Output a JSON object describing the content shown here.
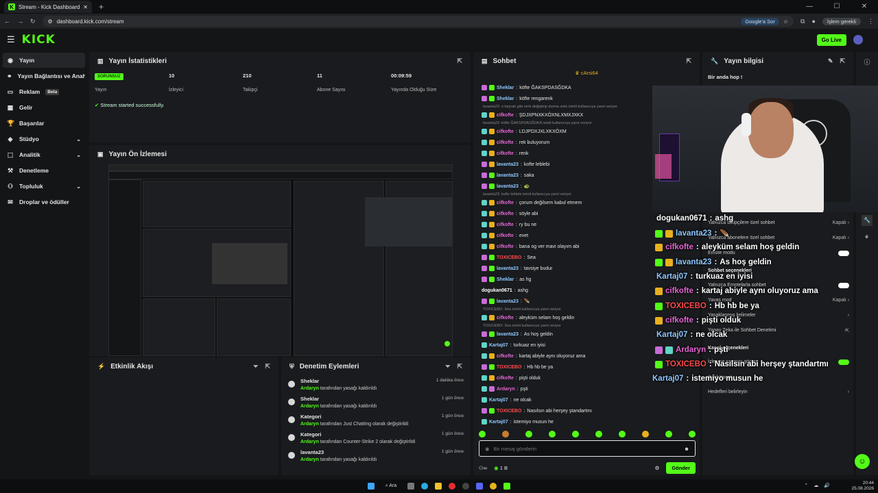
{
  "browser": {
    "tab_title": "Stream - Kick Dashboard",
    "url": "dashboard.kick.com/stream",
    "google_pill": "Google'a Sor",
    "update_label": "İşlem gerekli"
  },
  "header": {
    "logo": "KICK",
    "go_live": "Go Live"
  },
  "sidebar": {
    "items": [
      {
        "label": "Yayın",
        "icon": "broadcast-icon",
        "active": true
      },
      {
        "label": "Yayın Bağlantısı ve Anahtarı",
        "icon": "link-icon"
      },
      {
        "label": "Reklam",
        "icon": "ad-icon",
        "badge": "Beta"
      },
      {
        "label": "Gelir",
        "icon": "revenue-icon"
      },
      {
        "label": "Başarılar",
        "icon": "trophy-icon"
      },
      {
        "label": "Stüdyo",
        "icon": "studio-icon",
        "chevron": true
      },
      {
        "label": "Analitik",
        "icon": "analytics-icon",
        "chevron": true
      },
      {
        "label": "Denetleme",
        "icon": "gavel-icon"
      },
      {
        "label": "Topluluk",
        "icon": "community-icon",
        "chevron": true
      },
      {
        "label": "Droplar ve ödüller",
        "icon": "gift-icon"
      }
    ]
  },
  "stats": {
    "title": "Yayın İstatistikleri",
    "badge": "SORUNSUZ",
    "items": [
      {
        "value": "",
        "label": "Yayın"
      },
      {
        "value": "10",
        "label": "İzleyici"
      },
      {
        "value": "210",
        "label": "Takipçi"
      },
      {
        "value": "11",
        "label": "Abone Sayısı"
      },
      {
        "value": "00:09:59",
        "label": "Yayında Olduğu Süre"
      }
    ],
    "success_msg": "Stream started successfully."
  },
  "preview": {
    "title": "Yayın Ön İzlemesi"
  },
  "activity": {
    "title": "Etkinlik Akışı"
  },
  "moderation": {
    "title": "Denetim Eylemleri",
    "items": [
      {
        "title": "Sheklar",
        "by": "Ardaryn",
        "text": " tarafından yasağı kaldırıldı",
        "time": "1 dakika önce"
      },
      {
        "title": "Sheklar",
        "by": "Ardaryn",
        "text": " tarafından yasağı kaldırıldı",
        "time": "1 gün önce"
      },
      {
        "title": "Kategori",
        "by": "Ardaryn",
        "text": " tarafından Just Chatting olarak değiştirildi",
        "time": "1 gün önce"
      },
      {
        "title": "Kategori",
        "by": "Ardaryn",
        "text": " tarafından Counter-Strike 2 olarak değiştirildi",
        "time": "1 gün önce"
      },
      {
        "title": "lavanta23",
        "by": "Ardaryn",
        "text": " tarafından yasağı kaldırıldı",
        "time": "1 gün önce"
      }
    ]
  },
  "chat": {
    "title": "Sohbet",
    "pinned": "cArsi64",
    "messages": [
      {
        "user": "Sheklar",
        "color": "#8fc8ff",
        "b1": "#c86bd8",
        "b2": "#53fc18",
        "text": "köfte ĞAKSPDASĞDKA"
      },
      {
        "user": "Sheklar",
        "color": "#8fc8ff",
        "b1": "#c86bd8",
        "b2": "#53fc18",
        "text": "köfte rengarenk"
      },
      {
        "sys": "lavanta23: o bayrak gibi renk değiştirip durma artık isimli kullanıcıya yanıt veriyor"
      },
      {
        "user": "cifkofte",
        "color": "#e565d4",
        "b1": "#5fd4c8",
        "b2": "#e9b01e",
        "text": "ŞDJXPNXKXÖXNLXMXJXKX"
      },
      {
        "sys": "lavanta23: köfte ĞAKSPDASĞDKA isimli kullanıcıya yanıt veriyor"
      },
      {
        "user": "cifkofte",
        "color": "#e565d4",
        "b1": "#5fd4c8",
        "b2": "#e9b01e",
        "text": "LDJPDXJXLXKXÖXM"
      },
      {
        "user": "cifkofte",
        "color": "#e565d4",
        "b1": "#5fd4c8",
        "b2": "#e9b01e",
        "text": "rek buluyorum"
      },
      {
        "user": "cifkofte",
        "color": "#e565d4",
        "b1": "#5fd4c8",
        "b2": "#e9b01e",
        "text": "renk"
      },
      {
        "user": "lavanta23",
        "color": "#8fc8ff",
        "b1": "#c86bd8",
        "b2": "#e9b01e",
        "text": "kofte leblebi"
      },
      {
        "user": "lavanta23",
        "color": "#8fc8ff",
        "b1": "#c86bd8",
        "b2": "#53fc18",
        "text": "saka"
      },
      {
        "user": "lavanta23",
        "color": "#8fc8ff",
        "b1": "#c86bd8",
        "b2": "#53fc18",
        "text": "🐢"
      },
      {
        "sys": "lavanta23: kofte leblebi isimli kullanıcıya yanıt veriyor"
      },
      {
        "user": "cifkofte",
        "color": "#e565d4",
        "b1": "#5fd4c8",
        "b2": "#e9b01e",
        "text": "çorum değilsem kabul etmem"
      },
      {
        "user": "cifkofte",
        "color": "#e565d4",
        "b1": "#5fd4c8",
        "b2": "#e9b01e",
        "text": "söyle abi"
      },
      {
        "user": "cifkofte",
        "color": "#e565d4",
        "b1": "#5fd4c8",
        "b2": "#e9b01e",
        "text": "ry bu ne"
      },
      {
        "user": "cifkofte",
        "color": "#e565d4",
        "b1": "#5fd4c8",
        "b2": "#e9b01e",
        "text": "evet"
      },
      {
        "user": "cifkofte",
        "color": "#e565d4",
        "b1": "#5fd4c8",
        "b2": "#e9b01e",
        "text": "bana og ver mavi olayım abi"
      },
      {
        "user": "TOXICEBO",
        "color": "#ff4a4a",
        "b1": "#c86bd8",
        "b2": "#53fc18",
        "text": "Sea"
      },
      {
        "user": "lavanta23",
        "color": "#8fc8ff",
        "b1": "#c86bd8",
        "b2": "#53fc18",
        "text": "tavsiye budur"
      },
      {
        "user": "Sheklar",
        "color": "#8fc8ff",
        "b1": "#c86bd8",
        "b2": "#53fc18",
        "text": "as hg"
      },
      {
        "user": "dogukan0671",
        "color": "#ffffff",
        "b1": "",
        "b2": "",
        "text": "ashg"
      },
      {
        "user": "lavanta23",
        "color": "#8fc8ff",
        "b1": "#c86bd8",
        "b2": "#53fc18",
        "text": "🪶"
      },
      {
        "sys": "TOXICEBO: Sea isimli kullanıcıya yanıt veriyor"
      },
      {
        "user": "cifkofte",
        "color": "#e565d4",
        "b1": "#5fd4c8",
        "b2": "#e9b01e",
        "text": "aleyküm selam hoş geldin"
      },
      {
        "sys": "TOXICEBO: Sea isimli kullanıcıya yanıt veriyor"
      },
      {
        "user": "lavanta23",
        "color": "#8fc8ff",
        "b1": "#c86bd8",
        "b2": "#53fc18",
        "text": "As hoş geldin"
      },
      {
        "user": "Kartaj07",
        "color": "#8fc8ff",
        "b1": "#5fd4c8",
        "b2": "",
        "text": "turkuaz en iyisi"
      },
      {
        "user": "cifkofte",
        "color": "#e565d4",
        "b1": "#5fd4c8",
        "b2": "#e9b01e",
        "text": "kartaj abiyle aynı oluyoruz ama"
      },
      {
        "user": "TOXICEBO",
        "color": "#ff4a4a",
        "b1": "#c86bd8",
        "b2": "#53fc18",
        "text": "Hb hb be ya"
      },
      {
        "user": "cifkofte",
        "color": "#e565d4",
        "b1": "#5fd4c8",
        "b2": "#e9b01e",
        "text": "pişti olduk"
      },
      {
        "user": "Ardaryn",
        "color": "#e565d4",
        "b1": "#5fd4c8",
        "b2": "#c86bd8",
        "text": "pşti"
      },
      {
        "user": "Kartaj07",
        "color": "#8fc8ff",
        "b1": "#5fd4c8",
        "b2": "",
        "text": "ne olcak"
      },
      {
        "user": "TOXICEBO",
        "color": "#ff4a4a",
        "b1": "#c86bd8",
        "b2": "#53fc18",
        "text": "Nasılsın abi herşey ştandartmı"
      },
      {
        "user": "Kartaj07",
        "color": "#8fc8ff",
        "b1": "#5fd4c8",
        "b2": "",
        "text": "istemiyo musun he"
      }
    ],
    "input_placeholder": "Bir mesaj gönderin",
    "viewer_count": "1 B",
    "send_label": "Gönder"
  },
  "stream_info": {
    "title": "Yayın bilgisi",
    "stream_title": "Bir anda hop !",
    "settings": [
      {
        "label": "Yalnızca takipçilere özel sohbet",
        "value": "Kapalı",
        "type": "chevron"
      },
      {
        "label": "Yalnızca abonelere özel sohbet",
        "value": "Kapalı",
        "type": "chevron"
      },
      {
        "label": "Emote modu",
        "value": "",
        "type": "toggle-off"
      },
      {
        "label": "Sohbet seçenekleri",
        "value": "",
        "type": "heading"
      },
      {
        "label": "Yalnızca Emotelarla sohbet",
        "value": "",
        "type": "toggle-off"
      },
      {
        "label": "Yavaş mod",
        "value": "Kapalı",
        "type": "chevron"
      },
      {
        "label": "Yasaklanmış kelimeler",
        "value": "",
        "type": "chevron"
      },
      {
        "label": "Yapay Zeka ile Sohbet Denetimi",
        "value": "",
        "type": "ext"
      },
      {
        "label": "Kanal seçenekleri",
        "value": "",
        "type": "heading"
      },
      {
        "label": "İzlenme sayısını göster",
        "value": "",
        "type": "toggle-on"
      },
      {
        "label": "Raid Kanalı",
        "value": "",
        "type": "none"
      },
      {
        "label": "Hedefleri belirleyin",
        "value": "",
        "type": "chevron"
      }
    ]
  },
  "overlay_chat": [
    {
      "user": "dogukan0671",
      "color": "#ffffff",
      "b1": "",
      "b2": "",
      "text": "ashg"
    },
    {
      "user": "lavanta23",
      "color": "#8fc8ff",
      "b1": "#53fc18",
      "b2": "#e9b01e",
      "text": "🪶"
    },
    {
      "user": "cifkofte",
      "color": "#e565d4",
      "b1": "#e9b01e",
      "b2": "",
      "text": "aleyküm selam hoş geldin"
    },
    {
      "user": "lavanta23",
      "color": "#8fc8ff",
      "b1": "#53fc18",
      "b2": "#e9b01e",
      "text": "As hoş geldin"
    },
    {
      "user": "Kartaj07",
      "color": "#8fc8ff",
      "b1": "",
      "b2": "",
      "text": "turkuaz en iyisi"
    },
    {
      "user": "cifkofte",
      "color": "#e565d4",
      "b1": "#e9b01e",
      "b2": "",
      "text": "kartaj abiyle aynı oluyoruz ama"
    },
    {
      "user": "TOXICEBO",
      "color": "#ff4a4a",
      "b1": "#53fc18",
      "b2": "",
      "text": "Hb hb be ya"
    },
    {
      "user": "cifkofte",
      "color": "#e565d4",
      "b1": "#e9b01e",
      "b2": "",
      "text": "pişti olduk"
    },
    {
      "user": "Kartaj07",
      "color": "#8fc8ff",
      "b1": "",
      "b2": "",
      "text": "ne olcak"
    },
    {
      "user": "Ardaryn",
      "color": "#e565d4",
      "b1": "#c86bd8",
      "b2": "#5fd4c8",
      "text": "pşti"
    },
    {
      "user": "TOXICEBO",
      "color": "#ff4a4a",
      "b1": "#53fc18",
      "b2": "",
      "text": "Nasılsın abi herşey ştandartmı"
    },
    {
      "user": "Kartaj07",
      "color": "#8fc8ff",
      "b1": "",
      "b2": "",
      "text": "istemiyo musun he"
    }
  ],
  "taskbar": {
    "search": "Ara",
    "time": "20:44",
    "date": "25.08.2026"
  },
  "colors": {
    "accent": "#53fc18",
    "bg": "#141517",
    "panel": "#191b1e"
  }
}
